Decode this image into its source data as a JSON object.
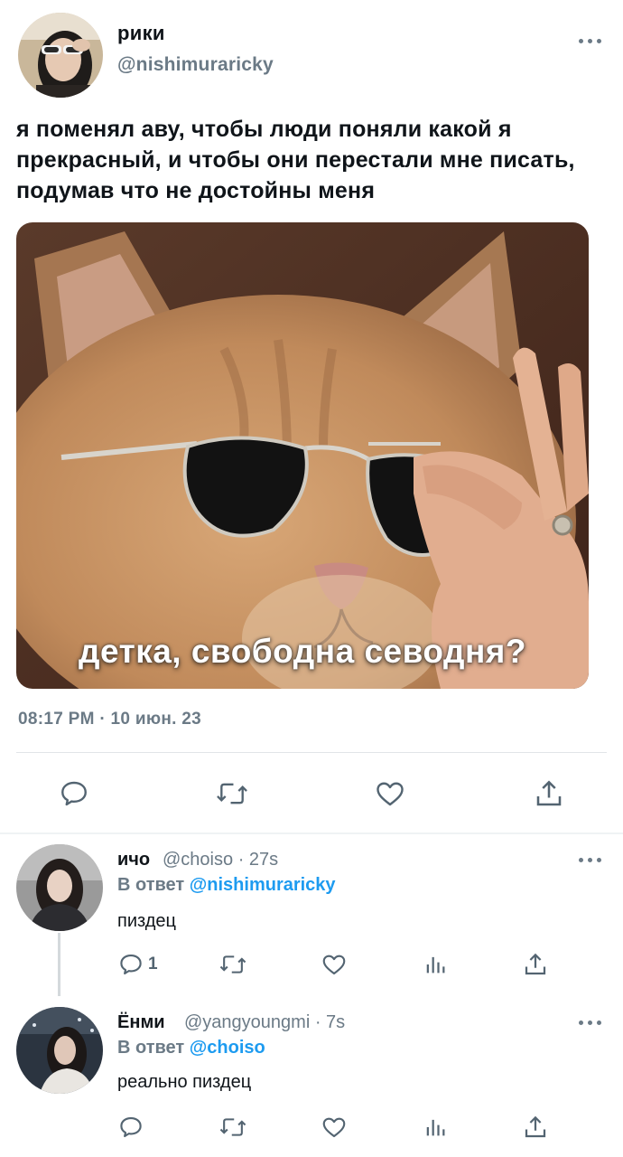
{
  "main_tweet": {
    "display_name": "рики",
    "handle": "@nishimuraricky",
    "text": "я поменял аву, чтобы люди поняли какой я прекрасный, и чтобы они перестали мне писать, подумав что не достойны меня",
    "media_caption": "детка, свободна севодня?",
    "timestamp": "08:17 PM · 10 июн. 23"
  },
  "replies": [
    {
      "display_name": "ичо",
      "handle": "@choiso",
      "time": "· 27s",
      "reply_to_label": "В ответ",
      "reply_to_handle": "@nishimuraricky",
      "text": "пиздец",
      "reply_count": "1"
    },
    {
      "display_name": "Ёнми",
      "handle": "@yangyoungmi",
      "time": "· 7s",
      "reply_to_label": "В ответ",
      "reply_to_handle": "@choiso",
      "text": "реально пиздец",
      "reply_count": ""
    }
  ],
  "icons": {
    "reply": "speech-bubble-icon",
    "retweet": "retweet-icon",
    "like": "heart-icon",
    "share": "share-icon",
    "views": "bar-chart-icon",
    "more": "more-dots-icon"
  },
  "colors": {
    "accent": "#1d9bf0",
    "secondary_text": "#6b7a86",
    "icon": "#536471"
  }
}
